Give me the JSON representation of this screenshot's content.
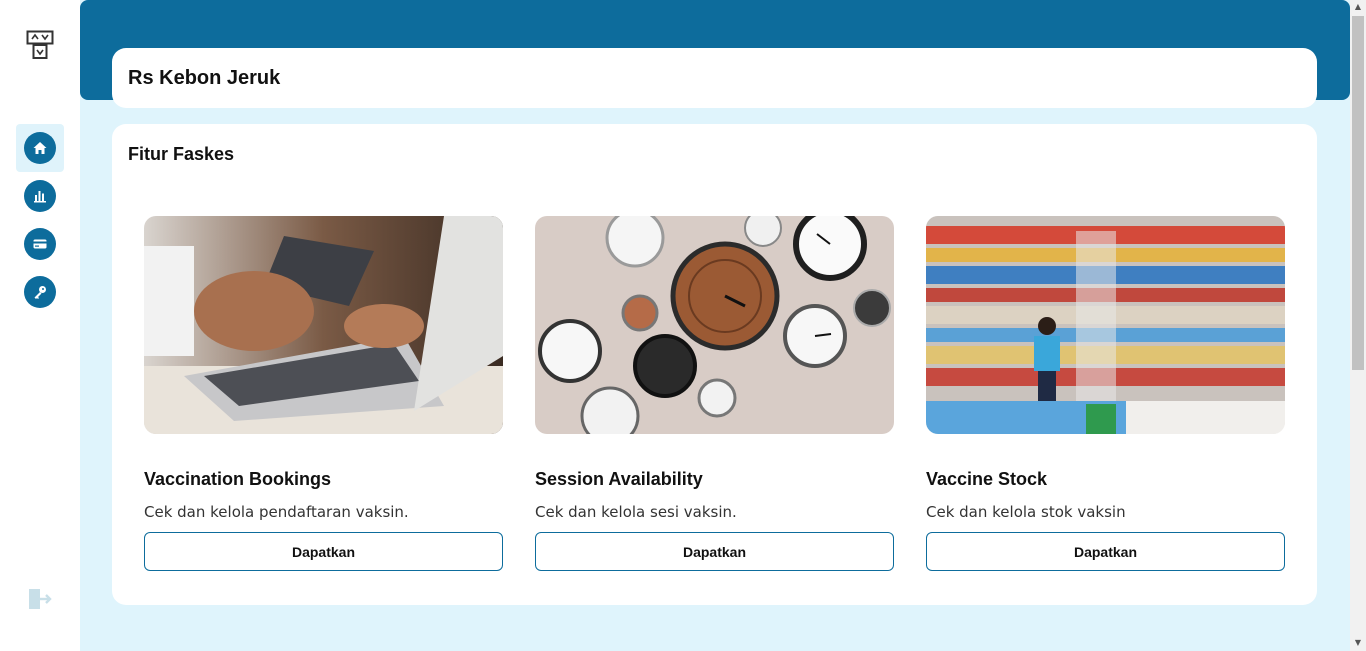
{
  "facility": {
    "name": "Rs Kebon Jeruk"
  },
  "panel": {
    "title": "Fitur Faskes"
  },
  "cards": [
    {
      "title": "Vaccination Bookings",
      "description": "Cek dan kelola pendaftaran vaksin.",
      "button": "Dapatkan"
    },
    {
      "title": "Session Availability",
      "description": "Cek dan kelola sesi vaksin.",
      "button": "Dapatkan"
    },
    {
      "title": "Vaccine Stock",
      "description": "Cek dan kelola stok vaksin",
      "button": "Dapatkan"
    }
  ],
  "sidebar": {
    "items": [
      {
        "icon": "home-icon"
      },
      {
        "icon": "chart-icon"
      },
      {
        "icon": "card-icon"
      },
      {
        "icon": "key-icon"
      }
    ],
    "logout_icon": "logout-icon"
  },
  "colors": {
    "primary": "#0d6c9c",
    "background": "#dff4fc"
  }
}
